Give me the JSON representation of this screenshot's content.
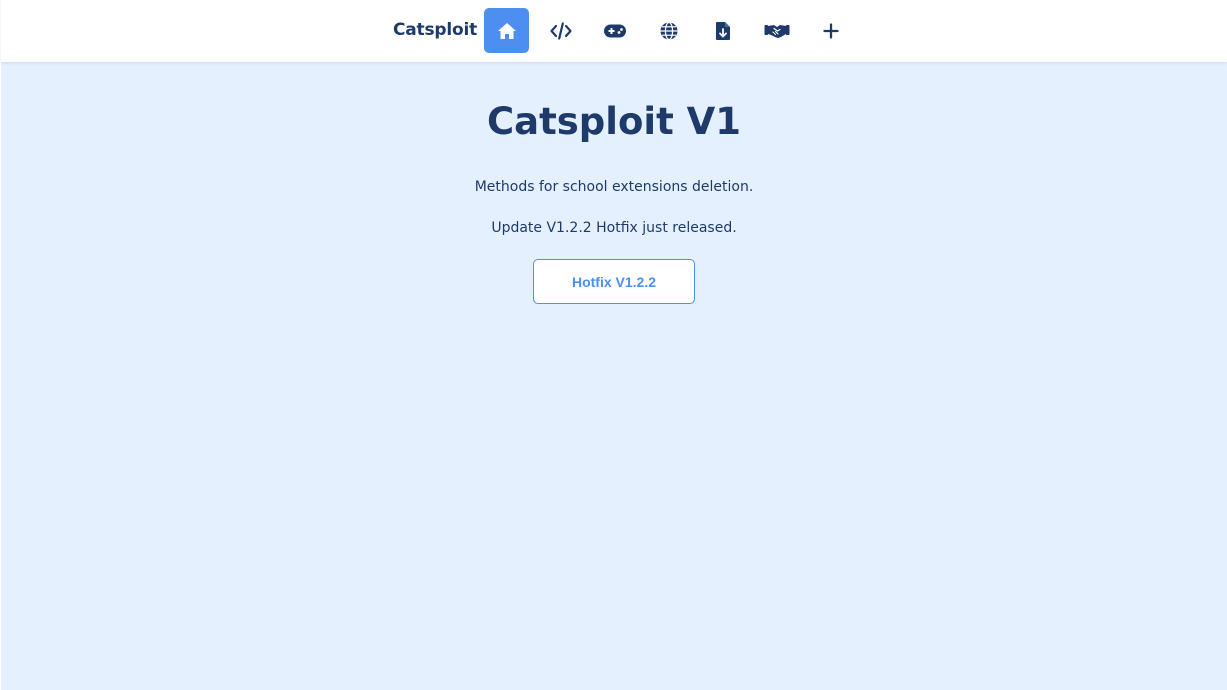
{
  "header": {
    "brand": "Catsploit",
    "nav_icons": [
      "home-icon",
      "code-icon",
      "gamepad-icon",
      "globe-icon",
      "file-download-icon",
      "handshake-icon",
      "plus-icon"
    ],
    "active_index": 0
  },
  "main": {
    "title": "Catsploit V1",
    "description": "Methods for school extensions deletion.",
    "update_note": "Update V1.2.2 Hotfix just released.",
    "hotfix_button": "Hotfix V1.2.2"
  },
  "colors": {
    "accent": "#4d8ff0",
    "text_dark": "#1d3a6b",
    "page_background": "#e4f0fd",
    "header_background": "#ffffff"
  }
}
